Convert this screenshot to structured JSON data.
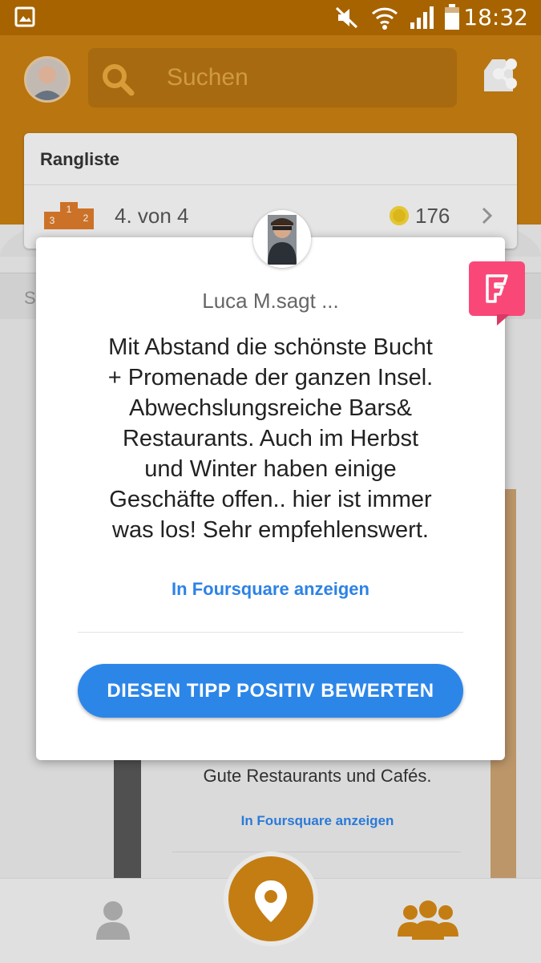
{
  "status_bar": {
    "time": "18:32"
  },
  "header": {
    "search_placeholder": "Suchen"
  },
  "leaderboard": {
    "title": "Rangliste",
    "rank": "4. von 4",
    "coins": "176",
    "podium": [
      "1",
      "2",
      "3"
    ]
  },
  "background": {
    "partial_tab": "S",
    "tip_text": "Gute Restaurants und Cafés.",
    "link": "In Foursquare anzeigen"
  },
  "dialog": {
    "author_says": "Luca M.sagt ...",
    "tip_lines": [
      "Mit Abstand die schönste Bucht",
      "+ Promenade der ganzen Insel.",
      "Abwechslungsreiche Bars&",
      "Restaurants. Auch im Herbst",
      "und Winter haben einige",
      "Geschäfte offen.. hier ist immer",
      "was los! Sehr empfehlenswert."
    ],
    "foursquare_link": "In Foursquare anzeigen",
    "upvote_button": "DIESEN TIPP POSITIV BEWERTEN"
  },
  "icons": [
    "image-icon",
    "mute-icon",
    "wifi-icon",
    "signal-icon",
    "battery-icon",
    "search-icon",
    "share-icon",
    "podium-icon",
    "coin-icon",
    "chevron-right-icon",
    "foursquare-icon",
    "person-icon",
    "location-pin-icon",
    "group-icon"
  ],
  "colors": {
    "accent": "#c47d12",
    "button": "#2c86e8",
    "foursquare": "#f94877"
  }
}
